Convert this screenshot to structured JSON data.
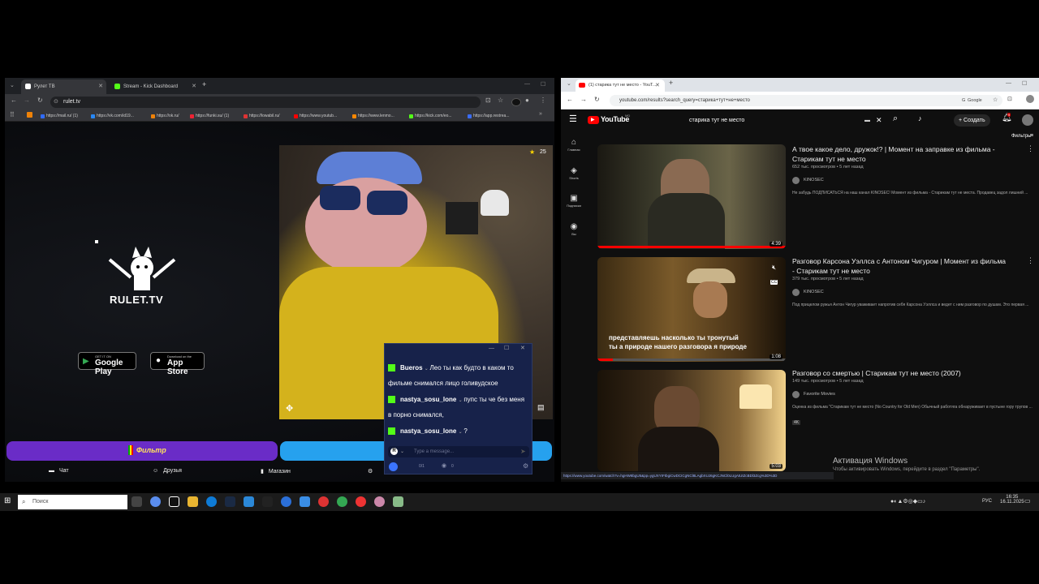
{
  "left_window": {
    "tabs": [
      {
        "label": "Рулет ТВ",
        "favicon_color": "#ffffff"
      },
      {
        "label": "Stream - Kick Dashboard",
        "favicon_color": "#53fc18"
      }
    ],
    "url": "rulet.tv",
    "bookmarks": [
      {
        "label": "https://mail.ru/ (1)",
        "color": "#2f6bff"
      },
      {
        "label": "https://vk.com/id19...",
        "color": "#2787f5"
      },
      {
        "label": "https://ok.ru/",
        "color": "#ee8208"
      },
      {
        "label": "https://funki.su/ (1)",
        "color": "#e23"
      },
      {
        "label": "https://lowabil.ru/",
        "color": "#d33"
      },
      {
        "label": "https://www.youtub...",
        "color": "#f00"
      },
      {
        "label": "https://www.lenmo...",
        "color": "#f80"
      },
      {
        "label": "https://kick.com/eo...",
        "color": "#53fc18"
      },
      {
        "label": "https://app.restrea...",
        "color": "#3a6cf4"
      }
    ],
    "logo_text": "RULET.TV",
    "google_play": {
      "small": "GET IT ON",
      "big": "Google Play"
    },
    "app_store": {
      "small": "Download on the",
      "big": "App Store"
    },
    "video_counter": "25",
    "filter_label": "Фильтр",
    "nav": {
      "chat": "Чат",
      "friends": "Друзья",
      "shop": "Магазин"
    }
  },
  "chat": {
    "messages": [
      {
        "user": "Bueros",
        "text": "Лео ты как будто в каком то фильме снимался лицо голивудское"
      },
      {
        "user": "nastya_sosu_lone",
        "text": "пупс ты че без меня в порно снимался,"
      },
      {
        "user": "nastya_sosu_lone",
        "text": "?"
      }
    ],
    "input_placeholder": "Type a message...",
    "counter": "0/1",
    "viewers": "0"
  },
  "right_window": {
    "tab_label": "(1) старика тут не место - YouT...",
    "url": "youtube.com/results?search_query=старика+тут+не+место",
    "logo": "YouTube",
    "logo_sup": "MD",
    "search_query": "старика тут не место",
    "create_label": "Создать",
    "notif_count": "9",
    "filters_label": "Фильтры",
    "sidebar": [
      {
        "label": "Главная",
        "glyph": "⌂"
      },
      {
        "label": "Shorts",
        "glyph": "◈"
      },
      {
        "label": "Подписки",
        "glyph": "▣"
      },
      {
        "label": "Вы",
        "glyph": "◉"
      }
    ],
    "videos": [
      {
        "title": "А твое какое дело, дружок!? | Момент на заправке из фильма - Старикам тут не место",
        "meta": "652 тыс. просмотров • 5 лет назад",
        "channel": "KINOSEC",
        "desc": "Не забудь ПОДПИСАТЬСЯ на наш канал KINOSEC! Момент из фильма - Старикам тут не места. Продавец задол лишний ...",
        "duration": "4:39"
      },
      {
        "title": "Разговор Карсона Уэллса с Антоном Чигуром | Момент из фильма - Старикам тут не место",
        "meta": "379 тыс. просмотров • 5 лет назад",
        "channel": "KINOSEC",
        "desc": "Под прицелом ружья Антон Чигур уваживает напротив себя Карсона Уэллса и ведет с ним разговор по душам. Это первая ...",
        "duration": "1:08",
        "subtitle_line1": "представляешь насколько ты тронутый",
        "subtitle_line2": "ты а природе нашего разговора я природе",
        "cc": "CC"
      },
      {
        "title": "Разговор со смертью | Старикам тут не место (2007)",
        "meta": "149 тыс. просмотров • 5 лет назад",
        "channel": "Favorite Movies",
        "desc": "Оценка из фильма \"Старикам тут не место (No Country for Old Men) Обычный работяга обнаруживает в пустыне гору трупов ...",
        "badge": "4K",
        "duration": "5:03"
      }
    ],
    "status_url": "https://www.youtube.com/watch?v=hgHW8bgU5&pp=ygUXYIFIbgiCwDCICgNCl8LAgbXUJ6gKCJNCl0LUgAtUtZcBDl3Zcg%3D%3D"
  },
  "activation": {
    "title": "Активация Windows",
    "text": "Чтобы активировать Windows, перейдите в раздел \"Параметры\"."
  },
  "taskbar": {
    "search_placeholder": "Поиск",
    "lang": "РУС",
    "time": "16:35",
    "date": "16.11.2025"
  }
}
